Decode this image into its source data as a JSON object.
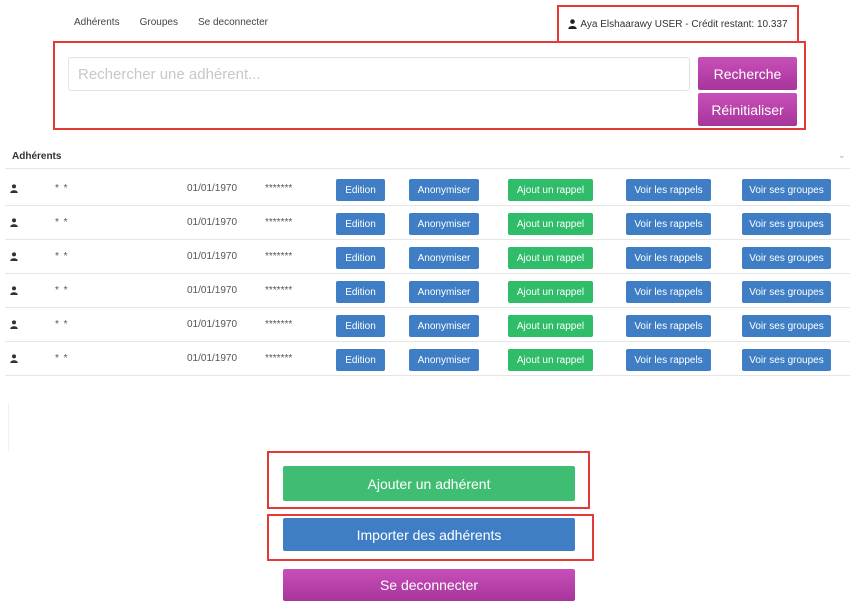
{
  "nav": {
    "items": [
      "Adhérents",
      "Groupes",
      "Se deconnecter"
    ]
  },
  "user": {
    "icon": "user-icon",
    "label": "Aya Elshaarawy USER - Crédit restant: 10.337"
  },
  "search": {
    "placeholder": "Rechercher une adhérent...",
    "value": "",
    "search_label": "Recherche",
    "reset_label": "Réinitialiser"
  },
  "table": {
    "title": "Adhérents",
    "collapse_icon": "chevron-down-icon",
    "rows": [
      {
        "name": "* *",
        "date": "01/01/1970",
        "password": "*******"
      },
      {
        "name": "* *",
        "date": "01/01/1970",
        "password": "*******"
      },
      {
        "name": "* *",
        "date": "01/01/1970",
        "password": "*******"
      },
      {
        "name": "* *",
        "date": "01/01/1970",
        "password": "*******"
      },
      {
        "name": "* *",
        "date": "01/01/1970",
        "password": "*******"
      },
      {
        "name": "* *",
        "date": "01/01/1970",
        "password": "*******"
      }
    ],
    "actions": {
      "edit": "Edition",
      "anonymize": "Anonymiser",
      "add_reminder": "Ajout un rappel",
      "view_reminders": "Voir les rappels",
      "view_groups": "Voir ses groupes"
    }
  },
  "footer": {
    "add_member": "Ajouter un adhérent",
    "import_members": "Importer des adhérents",
    "logout": "Se deconnecter"
  },
  "colors": {
    "blue": "#3f7ec5",
    "green": "#2fbd6a",
    "magenta": "#b93fab",
    "highlight": "#e53935"
  }
}
